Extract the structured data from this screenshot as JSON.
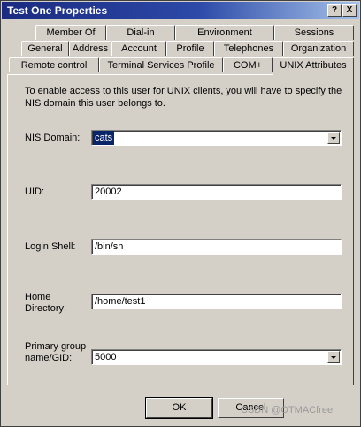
{
  "window": {
    "title": "Test One Properties",
    "help_glyph": "?",
    "close_glyph": "X"
  },
  "tabs_row1": [
    "Member Of",
    "Dial-in",
    "Environment",
    "Sessions"
  ],
  "tabs_row2": [
    "General",
    "Address",
    "Account",
    "Profile",
    "Telephones",
    "Organization"
  ],
  "tabs_row3": [
    "Remote control",
    "Terminal Services Profile",
    "COM+",
    "UNIX Attributes"
  ],
  "active_tab": "UNIX Attributes",
  "info_text": "To enable access to this user for UNIX clients, you will have to specify the NIS domain this user belongs to.",
  "fields": {
    "nis_domain": {
      "label": "NIS Domain:",
      "value": "cats"
    },
    "uid": {
      "label": "UID:",
      "value": "20002"
    },
    "login_shell": {
      "label": "Login Shell:",
      "value": "/bin/sh"
    },
    "home_directory": {
      "label_line1": "Home",
      "label_line2": "Directory:",
      "value": "/home/test1"
    },
    "primary_group": {
      "label_line1": "Primary group",
      "label_line2": "name/GID:",
      "value": "5000"
    }
  },
  "buttons": {
    "ok": "OK",
    "cancel": "Cancel"
  },
  "watermark": "CSDN @OTMACfree"
}
